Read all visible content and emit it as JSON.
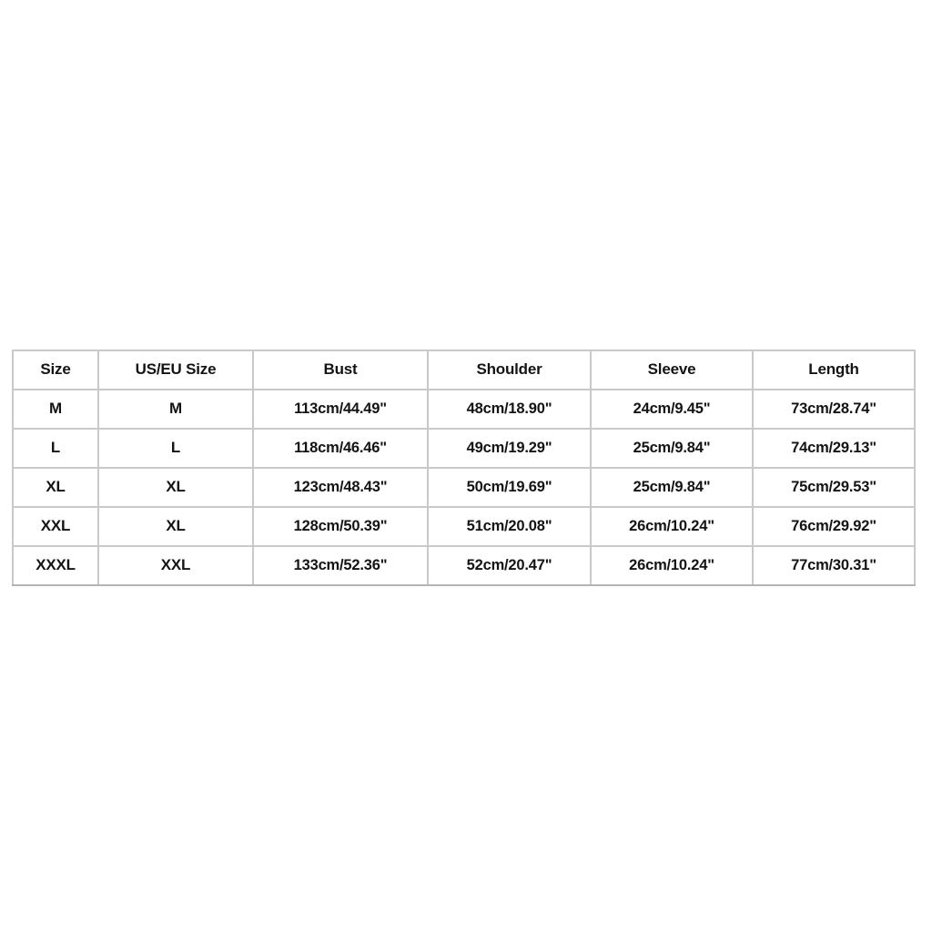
{
  "table": {
    "name": "garment-size-chart",
    "columns": [
      "Size",
      "US/EU Size",
      "Bust",
      "Shoulder",
      "Sleeve",
      "Length"
    ],
    "rows": [
      {
        "size": "M",
        "us_eu_size": "M",
        "bust": "113cm/44.49\"",
        "shoulder": "48cm/18.90\"",
        "sleeve": "24cm/9.45\"",
        "length": "73cm/28.74\""
      },
      {
        "size": "L",
        "us_eu_size": "L",
        "bust": "118cm/46.46\"",
        "shoulder": "49cm/19.29\"",
        "sleeve": "25cm/9.84\"",
        "length": "74cm/29.13\""
      },
      {
        "size": "XL",
        "us_eu_size": "XL",
        "bust": "123cm/48.43\"",
        "shoulder": "50cm/19.69\"",
        "sleeve": "25cm/9.84\"",
        "length": "75cm/29.53\""
      },
      {
        "size": "XXL",
        "us_eu_size": "XL",
        "bust": "128cm/50.39\"",
        "shoulder": "51cm/20.08\"",
        "sleeve": "26cm/10.24\"",
        "length": "76cm/29.92\""
      },
      {
        "size": "XXXL",
        "us_eu_size": "XXL",
        "bust": "133cm/52.36\"",
        "shoulder": "52cm/20.47\"",
        "sleeve": "26cm/10.24\"",
        "length": "77cm/30.31\""
      }
    ]
  },
  "style": {
    "background": "#ffffff",
    "border_color": "#c9c9c9",
    "text_color": "#141414"
  }
}
